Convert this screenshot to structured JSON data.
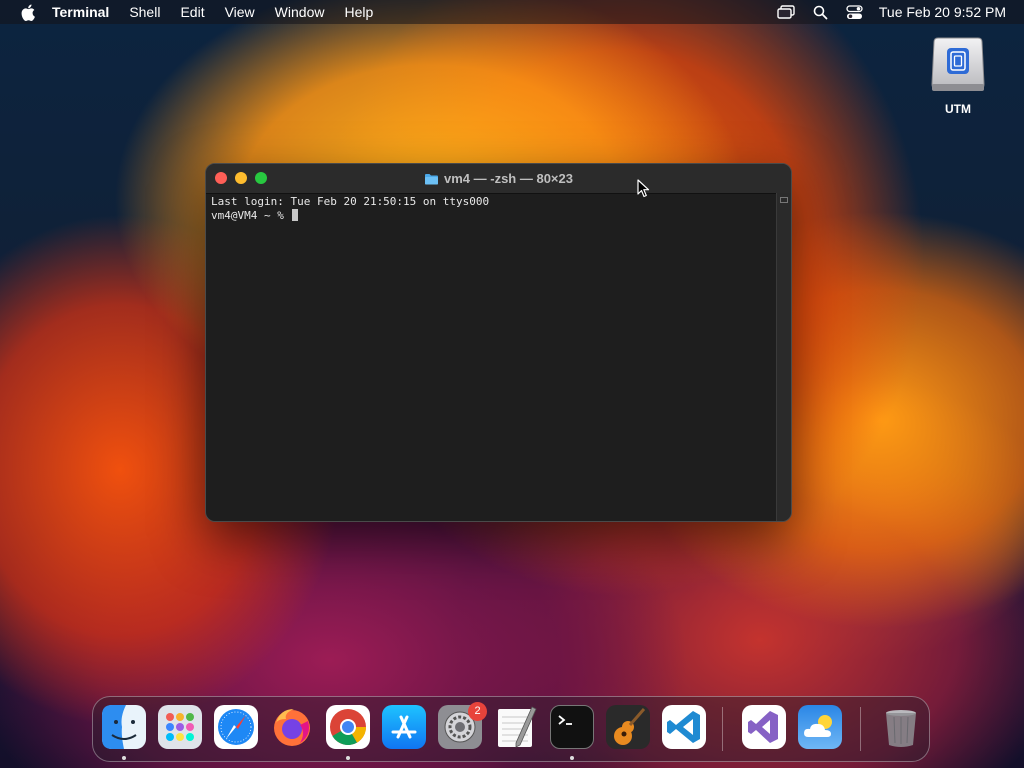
{
  "menubar": {
    "app_name": "Terminal",
    "menus": [
      "Shell",
      "Edit",
      "View",
      "Window",
      "Help"
    ],
    "clock": "Tue Feb 20  9:52 PM",
    "status_icons": [
      "screen-mirroring-icon",
      "spotlight-search-icon",
      "control-center-icon"
    ]
  },
  "desktop": {
    "icons": [
      {
        "label": "UTM",
        "icon": "disk-drive-icon"
      }
    ]
  },
  "terminal": {
    "title": "vm4 — -zsh — 80×23",
    "lines": [
      "Last login: Tue Feb 20 21:50:15 on ttys000",
      "vm4@VM4 ~ % "
    ]
  },
  "dock": {
    "apps": [
      {
        "name": "Finder",
        "icon": "finder-icon",
        "running": true
      },
      {
        "name": "Launchpad",
        "icon": "launchpad-icon",
        "running": false
      },
      {
        "name": "Safari",
        "icon": "safari-icon",
        "running": false
      },
      {
        "name": "Firefox",
        "icon": "firefox-icon",
        "running": false
      },
      {
        "name": "Google Chrome",
        "icon": "chrome-icon",
        "running": true
      },
      {
        "name": "App Store",
        "icon": "app-store-icon",
        "running": false
      },
      {
        "name": "System Settings",
        "icon": "system-settings-icon",
        "running": false,
        "badge": "2"
      },
      {
        "name": "TextEdit",
        "icon": "textedit-icon",
        "running": false
      },
      {
        "name": "Terminal",
        "icon": "terminal-icon",
        "running": true
      },
      {
        "name": "GarageBand",
        "icon": "garageband-icon",
        "running": false
      },
      {
        "name": "Visual Studio Code",
        "icon": "vscode-icon",
        "running": false
      },
      {
        "name": "Visual Studio",
        "icon": "visual-studio-icon",
        "running": false
      },
      {
        "name": "Weather",
        "icon": "weather-icon",
        "running": false
      },
      {
        "name": "Trash",
        "icon": "trash-icon",
        "running": false
      }
    ]
  },
  "colors": {
    "close": "#ff5f57",
    "minimize": "#febc2e",
    "zoom": "#28c840",
    "terminal_bg": "#1e1e1e",
    "badge": "#e8433b"
  }
}
